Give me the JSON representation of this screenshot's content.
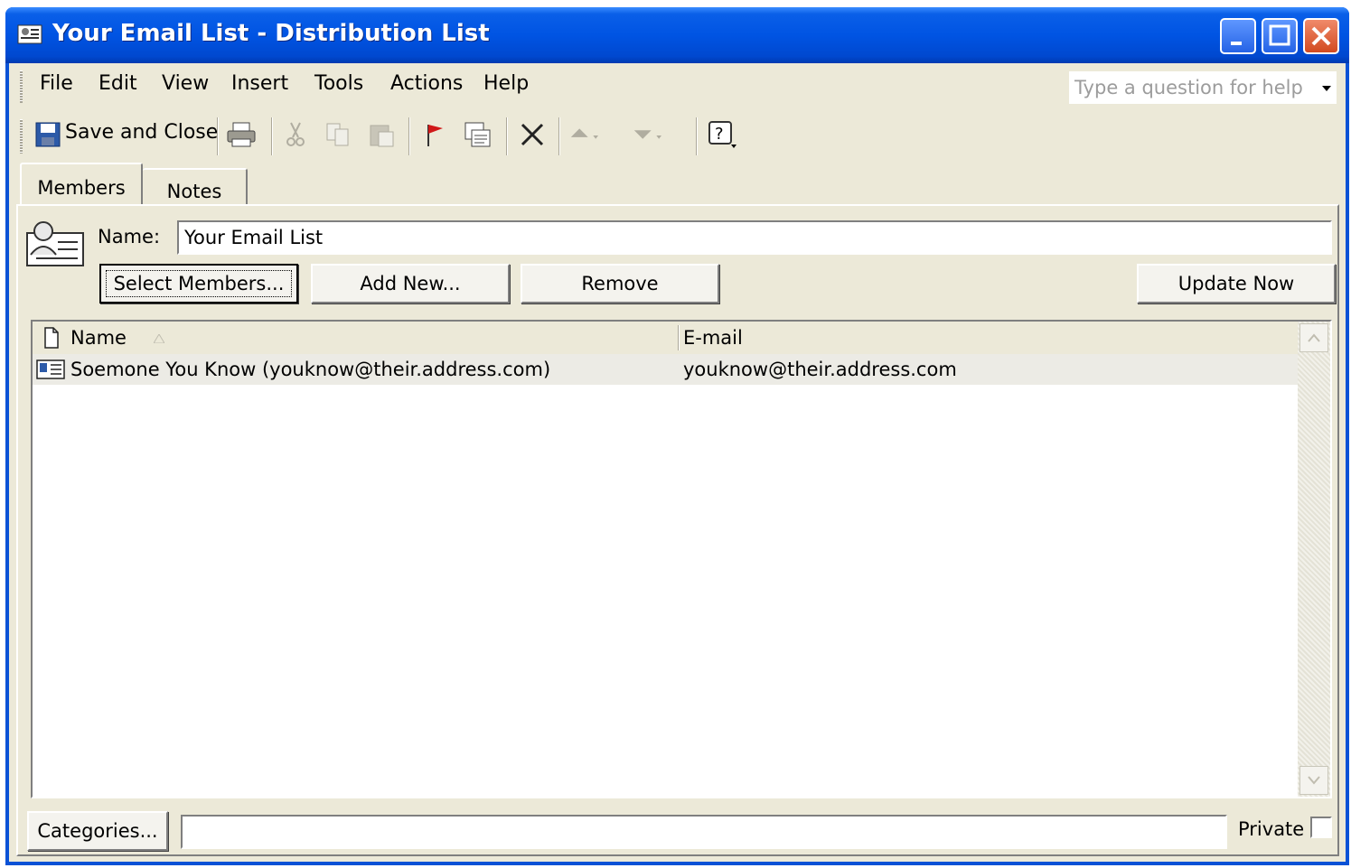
{
  "window": {
    "title": "Your Email List - Distribution List"
  },
  "menubar": {
    "items": [
      "File",
      "Edit",
      "View",
      "Insert",
      "Tools",
      "Actions",
      "Help"
    ],
    "help_placeholder": "Type a question for help"
  },
  "toolbar": {
    "save_and_close": "Save and Close",
    "icons": [
      "save-icon",
      "print-icon",
      "cut-icon",
      "copy-icon",
      "paste-icon",
      "flag-icon",
      "address-card-icon",
      "delete-icon",
      "previous-item-icon",
      "next-item-icon",
      "help-icon"
    ]
  },
  "tabs": [
    {
      "label": "Members",
      "active": true
    },
    {
      "label": "Notes",
      "active": false
    }
  ],
  "members": {
    "name_label": "Name:",
    "name_value": "Your Email List",
    "buttons": {
      "select_members": "Select Members...",
      "add_new": "Add New...",
      "remove": "Remove",
      "update_now": "Update Now"
    },
    "list": {
      "columns": [
        "Name",
        "E-mail"
      ],
      "rows": [
        {
          "name": "Soemone You Know (youknow@their.address.com)",
          "email": "youknow@their.address.com"
        }
      ]
    }
  },
  "footer": {
    "categories_button": "Categories...",
    "categories_value": "",
    "private_label": "Private",
    "private_checked": false
  },
  "colors": {
    "titlebar": "#0054e3",
    "client": "#ece9d8",
    "selected_row": "#ecebe5"
  }
}
